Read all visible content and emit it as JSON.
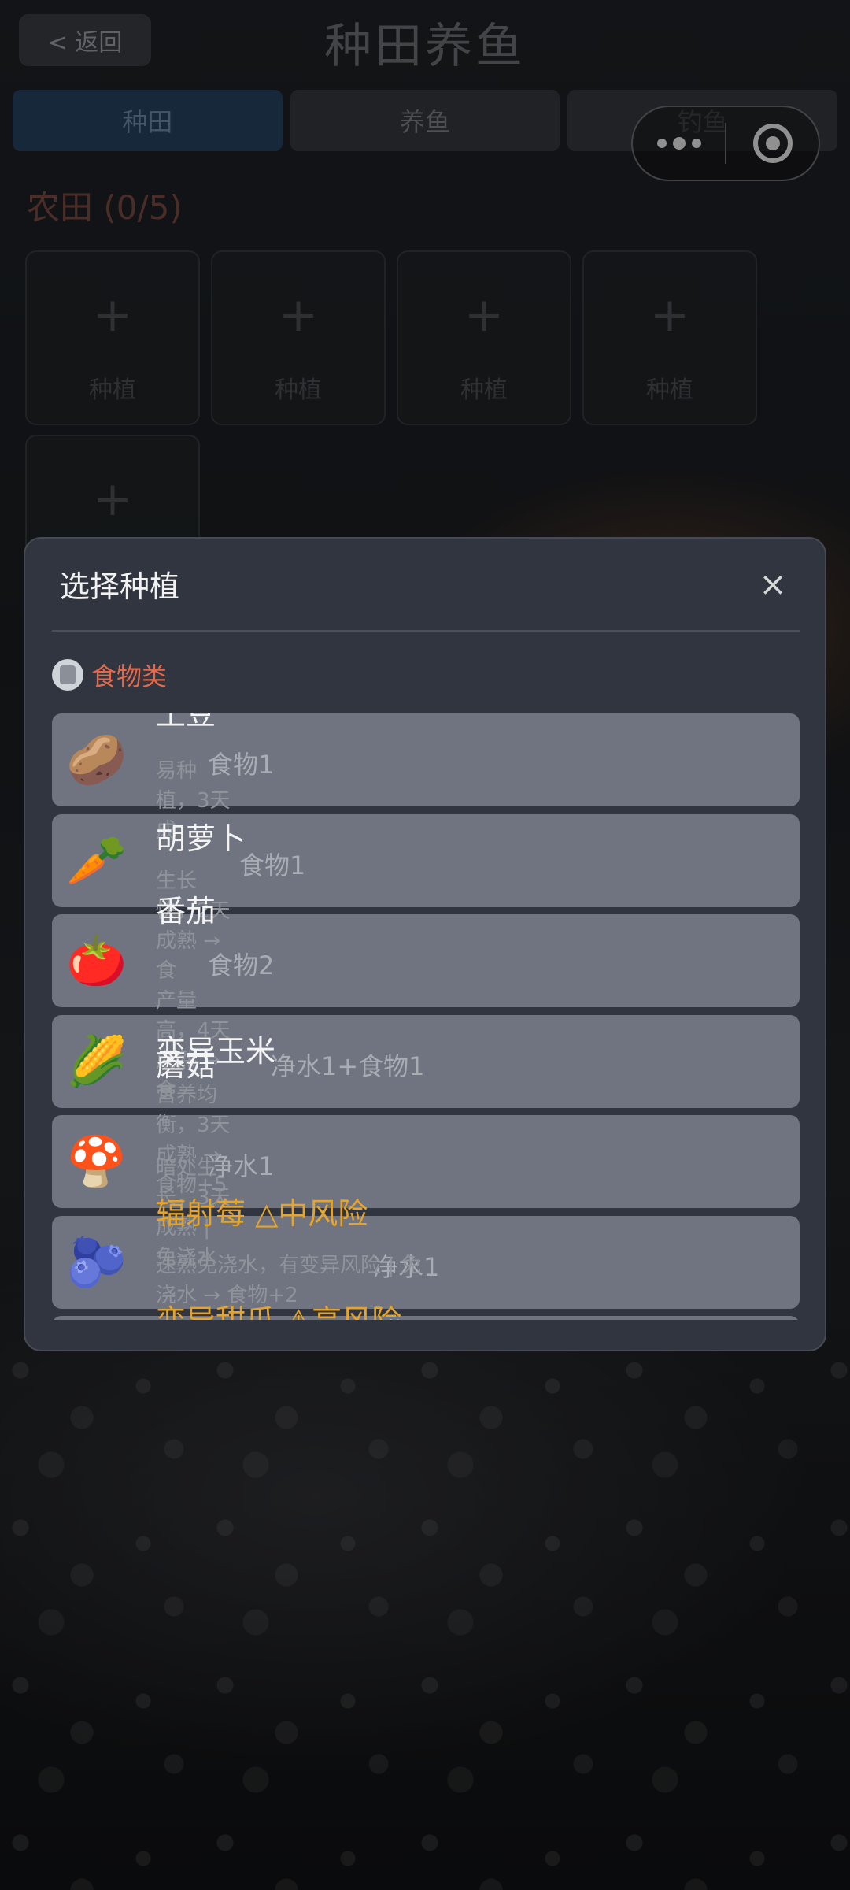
{
  "header": {
    "back_label": "< 返回",
    "title": "种田养鱼",
    "tabs": [
      "种田",
      "养鱼",
      "钓鱼"
    ]
  },
  "farm": {
    "title": "农田 (0/5)",
    "plot_plus": "+",
    "plot_label": "种植"
  },
  "modal": {
    "title": "选择种植",
    "close": "×",
    "category": "食物类",
    "items": [
      {
        "name": "土豆",
        "icon": "🥔",
        "desc": "易种植，3天成",
        "cost": "食物1"
      },
      {
        "name": "胡萝卜",
        "icon": "🥕",
        "desc": "生长快，2天成熟 → 食",
        "cost": "食物1"
      },
      {
        "name": "番茄",
        "icon": "🍅",
        "desc": "产量高，4天成熟 → 食",
        "cost": "食物2"
      },
      {
        "name": "变异玉米",
        "icon": "🌽",
        "desc": "营养均衡，3天成熟 → 食物+5",
        "cost": "净水1+食物1"
      },
      {
        "name": "蘑菇",
        "icon": "🍄",
        "desc": "暗处生长，3天成熟 | 免浇水",
        "cost": "净水1"
      },
      {
        "name": "辐射莓 △中风险",
        "icon": "🫐",
        "desc": "速熟免浇水，有变异风险 | 免浇水 → 食物+2",
        "cost": "净水1"
      },
      {
        "name": "变异甜瓜 ⚠高风险"
      }
    ]
  }
}
